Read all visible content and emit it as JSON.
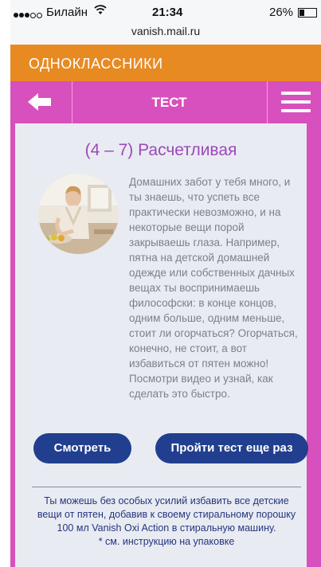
{
  "status_bar": {
    "carrier": "Билайн",
    "time": "21:34",
    "battery": "26%",
    "url": "vanish.mail.ru"
  },
  "site": {
    "name": "ОДНОКЛАССНИКИ"
  },
  "nav": {
    "title": "ТЕСТ",
    "back_icon": "arrow-left-icon",
    "menu_icon": "hamburger-menu-icon"
  },
  "result": {
    "title": "(4 – 7) Расчетливая",
    "image": "woman-cooking-photo",
    "description": "Домашних забот у тебя много, и ты знаешь, что успеть все практически невозможно, и на некоторые вещи порой закрываешь глаза. Например, пятна на детской домашней одежде или собственных дачных вещах ты воспринимаешь философски: в конце концов, одним больше, одним меньше, стоит ли огорчаться? Огорчаться, конечно, не стоит, а вот избавиться от пятен можно! Посмотри видео и узнай, как сделать это быстро."
  },
  "actions": {
    "watch_label": "Смотреть",
    "retry_label": "Пройти тест еще раз"
  },
  "footer": {
    "note": "Ты можешь без особых усилий избавить все детские вещи от пятен, добавив к своему стиральному порошку 100 мл Vanish Oxi Action в стиральную машину.",
    "footnote": "* см. инструкцию на упаковке"
  },
  "colors": {
    "header_orange": "#e88a22",
    "nav_pink": "#d850bd",
    "title_purple": "#9b49b9",
    "button_navy": "#213f8e"
  }
}
